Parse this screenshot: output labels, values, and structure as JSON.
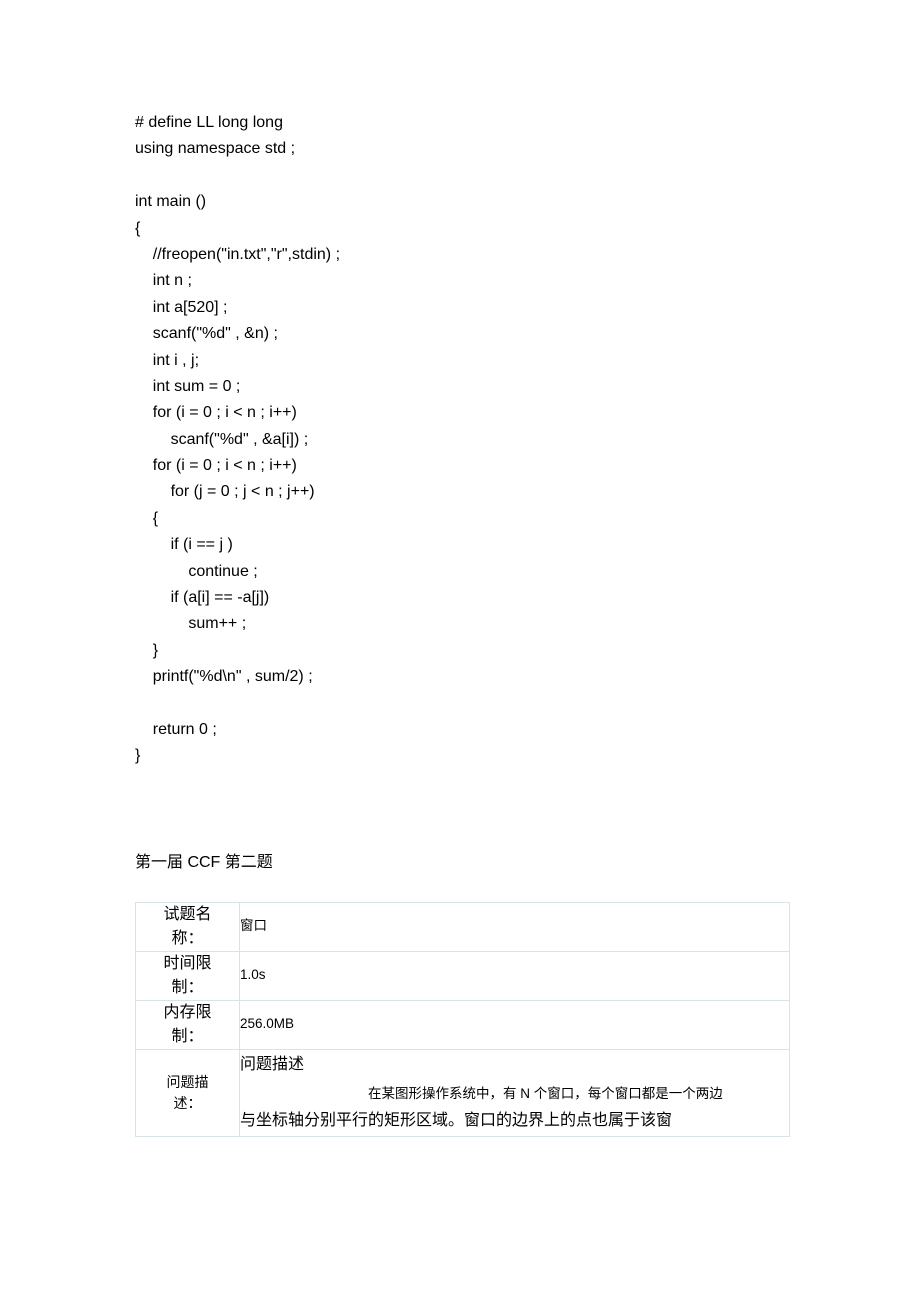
{
  "code": "# define LL long long\nusing namespace std ;\n\nint main ()\n{\n    //freopen(\"in.txt\",\"r\",stdin) ;\n    int n ;\n    int a[520] ;\n    scanf(\"%d\" , &n) ;\n    int i , j;\n    int sum = 0 ;\n    for (i = 0 ; i < n ; i++)\n        scanf(\"%d\" , &a[i]) ;\n    for (i = 0 ; i < n ; i++)\n        for (j = 0 ; j < n ; j++)\n    {\n        if (i == j )\n            continue ;\n        if (a[i] == -a[j])\n            sum++ ;\n    }\n    printf(\"%d\\n\" , sum/2) ;\n\n    return 0 ;\n}",
  "heading": "第一届 CCF 第二题",
  "table": {
    "rows": [
      {
        "label_l1": "试题名",
        "label_l2": "称：",
        "value": "窗口"
      },
      {
        "label_l1": "时间限",
        "label_l2": "制：",
        "value": "1.0s"
      },
      {
        "label_l1": "内存限",
        "label_l2": "制：",
        "value": "256.0MB"
      }
    ],
    "desc_label_l1": "问题描",
    "desc_label_l2": "述：",
    "desc_title": "问题描述",
    "desc_line1_prefix_spaces": "",
    "desc_line1": "在某图形操作系统中，有 N 个窗口，每个窗口都是一个两边",
    "desc_line2": "与坐标轴分别平行的矩形区域。窗口的边界上的点也属于该窗"
  }
}
